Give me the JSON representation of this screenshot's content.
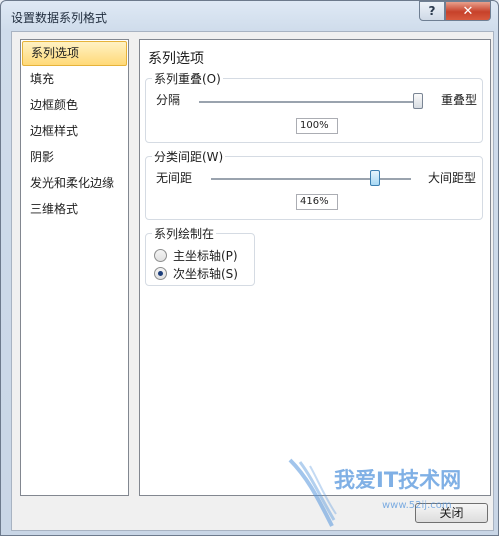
{
  "window": {
    "title": "设置数据系列格式",
    "help": "?",
    "close": "✕"
  },
  "nav": {
    "items": [
      "系列选项",
      "填充",
      "边框颜色",
      "边框样式",
      "阴影",
      "发光和柔化边缘",
      "三维格式"
    ],
    "selected_index": 0
  },
  "panel": {
    "title": "系列选项",
    "overlap": {
      "legend": "系列重叠(O)",
      "min_label": "分隔",
      "max_label": "重叠型",
      "value": "100%",
      "slider_position": 1.0
    },
    "gap": {
      "legend": "分类间距(W)",
      "min_label": "无间距",
      "max_label": "大间距型",
      "value": "416%",
      "slider_position": 0.83
    },
    "axis": {
      "legend": "系列绘制在",
      "options": [
        {
          "label": "主坐标轴(P)",
          "checked": false
        },
        {
          "label": "次坐标轴(S)",
          "checked": true
        }
      ]
    }
  },
  "buttons": {
    "close": "关闭"
  },
  "watermark": {
    "text": "我爱IT技术网",
    "sub": "www.52ij.com"
  }
}
